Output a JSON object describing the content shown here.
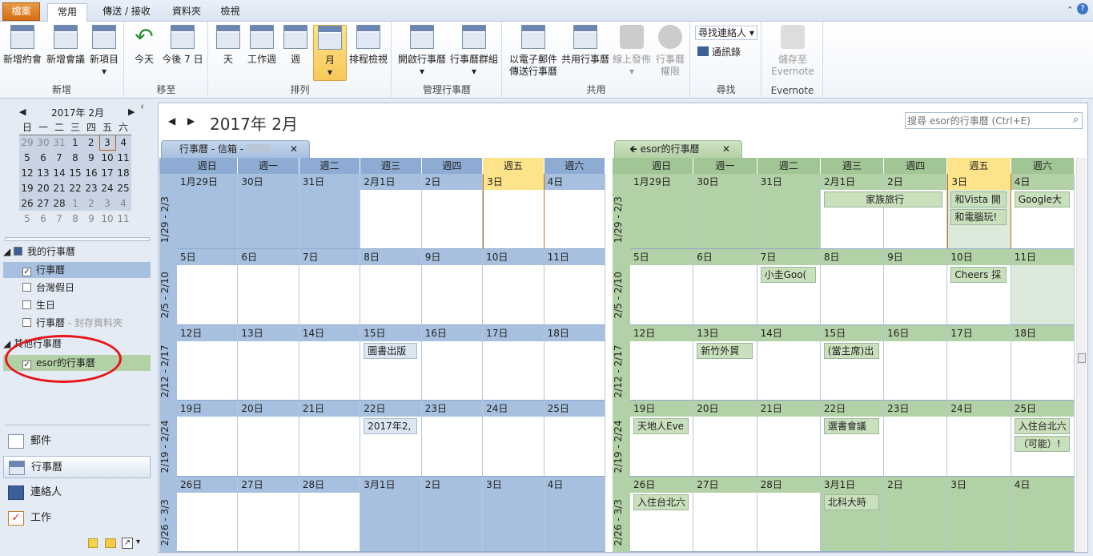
{
  "ribbon": {
    "tabs": [
      "檔案",
      "常用",
      "傳送 / 接收",
      "資料夾",
      "檢視"
    ],
    "groups": {
      "new": "新增",
      "goto": "移至",
      "arrange": "排列",
      "manage": "管理行事曆",
      "share": "共用",
      "find": "尋找",
      "evernote": "Evernote"
    },
    "buttons": {
      "new_appt": "新增約會",
      "new_meeting": "新增會議",
      "new_items": "新項目",
      "today": "今天",
      "next7": "今後 7 日",
      "day": "天",
      "workweek": "工作週",
      "week": "週",
      "month": "月",
      "schedule": "排程檢視",
      "open_cal": "開啟行事曆",
      "cal_groups": "行事曆群組",
      "email_cal_1": "以電子郵件",
      "email_cal_2": "傳送行事曆",
      "share_cal": "共用行事曆",
      "publish": "線上發佈",
      "perm_1": "行事曆",
      "perm_2": "權限",
      "find_contact": "尋找連絡人",
      "address_book": "通訊錄",
      "save_en_1": "儲存至",
      "save_en_2": "Evernote"
    }
  },
  "minical": {
    "title": "2017年 2月",
    "weekdays": [
      "日",
      "一",
      "二",
      "三",
      "四",
      "五",
      "六"
    ],
    "weeks": [
      [
        "29",
        "30",
        "31",
        "1",
        "2",
        "3",
        "4"
      ],
      [
        "5",
        "6",
        "7",
        "8",
        "9",
        "10",
        "11"
      ],
      [
        "12",
        "13",
        "14",
        "15",
        "16",
        "17",
        "18"
      ],
      [
        "19",
        "20",
        "21",
        "22",
        "23",
        "24",
        "25"
      ],
      [
        "26",
        "27",
        "28",
        "1",
        "2",
        "3",
        "4"
      ],
      [
        "5",
        "6",
        "7",
        "8",
        "9",
        "10",
        "11"
      ]
    ]
  },
  "folders": {
    "my_calendars": "我的行事曆",
    "cal": "行事曆",
    "tw_holidays": "台灣假日",
    "birthdays": "生日",
    "cal_archive": "行事曆",
    "archive_suffix": "- 封存資料夾",
    "other_calendars": "其他行事曆",
    "esor": "esor的行事曆"
  },
  "nav": {
    "mail": "郵件",
    "calendar": "行事曆",
    "contacts": "連絡人",
    "tasks": "工作"
  },
  "view": {
    "title": "2017年 2月",
    "search_placeholder": "搜尋 esor的行事曆 (Ctrl+E)",
    "tab_blue": "行事曆 - 信箱 -",
    "tab_green": "esor的行事曆"
  },
  "weekdays": [
    "週日",
    "週一",
    "週二",
    "週三",
    "週四",
    "週五",
    "週六"
  ],
  "weeks": [
    {
      "label": "1/29 - 2/3",
      "days": [
        "1月29日",
        "30日",
        "31日",
        "2月1日",
        "2日",
        "3日",
        "4日"
      ]
    },
    {
      "label": "2/5 - 2/10",
      "days": [
        "5日",
        "6日",
        "7日",
        "8日",
        "9日",
        "10日",
        "11日"
      ]
    },
    {
      "label": "2/12 - 2/17",
      "days": [
        "12日",
        "13日",
        "14日",
        "15日",
        "16日",
        "17日",
        "18日"
      ]
    },
    {
      "label": "2/19 - 2/24",
      "days": [
        "19日",
        "20日",
        "21日",
        "22日",
        "23日",
        "24日",
        "25日"
      ]
    },
    {
      "label": "2/26 - 3/3",
      "days": [
        "26日",
        "27日",
        "28日",
        "3月1日",
        "2日",
        "3日",
        "4日"
      ]
    }
  ],
  "appts_blue": [
    {
      "w": 2,
      "d": 3,
      "text": "圖書出版"
    },
    {
      "w": 3,
      "d": 3,
      "text": "2017年2,"
    }
  ],
  "appts_green": [
    {
      "w": 0,
      "d": 3,
      "span": 2,
      "text": "家族旅行"
    },
    {
      "w": 0,
      "d": 5,
      "text": "和Vista 開"
    },
    {
      "w": 0,
      "d": 5,
      "row": 1,
      "text": "和電腦玩!"
    },
    {
      "w": 0,
      "d": 6,
      "text": "Google大"
    },
    {
      "w": 1,
      "d": 2,
      "text": "小圭Goo("
    },
    {
      "w": 1,
      "d": 5,
      "text": "Cheers 採"
    },
    {
      "w": 2,
      "d": 1,
      "text": "新竹外貿"
    },
    {
      "w": 2,
      "d": 3,
      "text": "(當主席)出"
    },
    {
      "w": 3,
      "d": 0,
      "text": "天地人Eve"
    },
    {
      "w": 3,
      "d": 3,
      "text": "選書會議"
    },
    {
      "w": 3,
      "d": 6,
      "text": "入住台北六"
    },
    {
      "w": 3,
      "d": 6,
      "row": 1,
      "text": "（可能）!"
    },
    {
      "w": 4,
      "d": 0,
      "text": "入住台北六"
    },
    {
      "w": 4,
      "d": 3,
      "text": "北科大時"
    }
  ],
  "colors": {
    "blue_bg": "#a7c0e0",
    "blue_hdr": "#8eacd3",
    "green_bg": "#b3d1a6",
    "green_hdr": "#a2c595",
    "today": "#fde38a",
    "accent": "#d46c12"
  }
}
